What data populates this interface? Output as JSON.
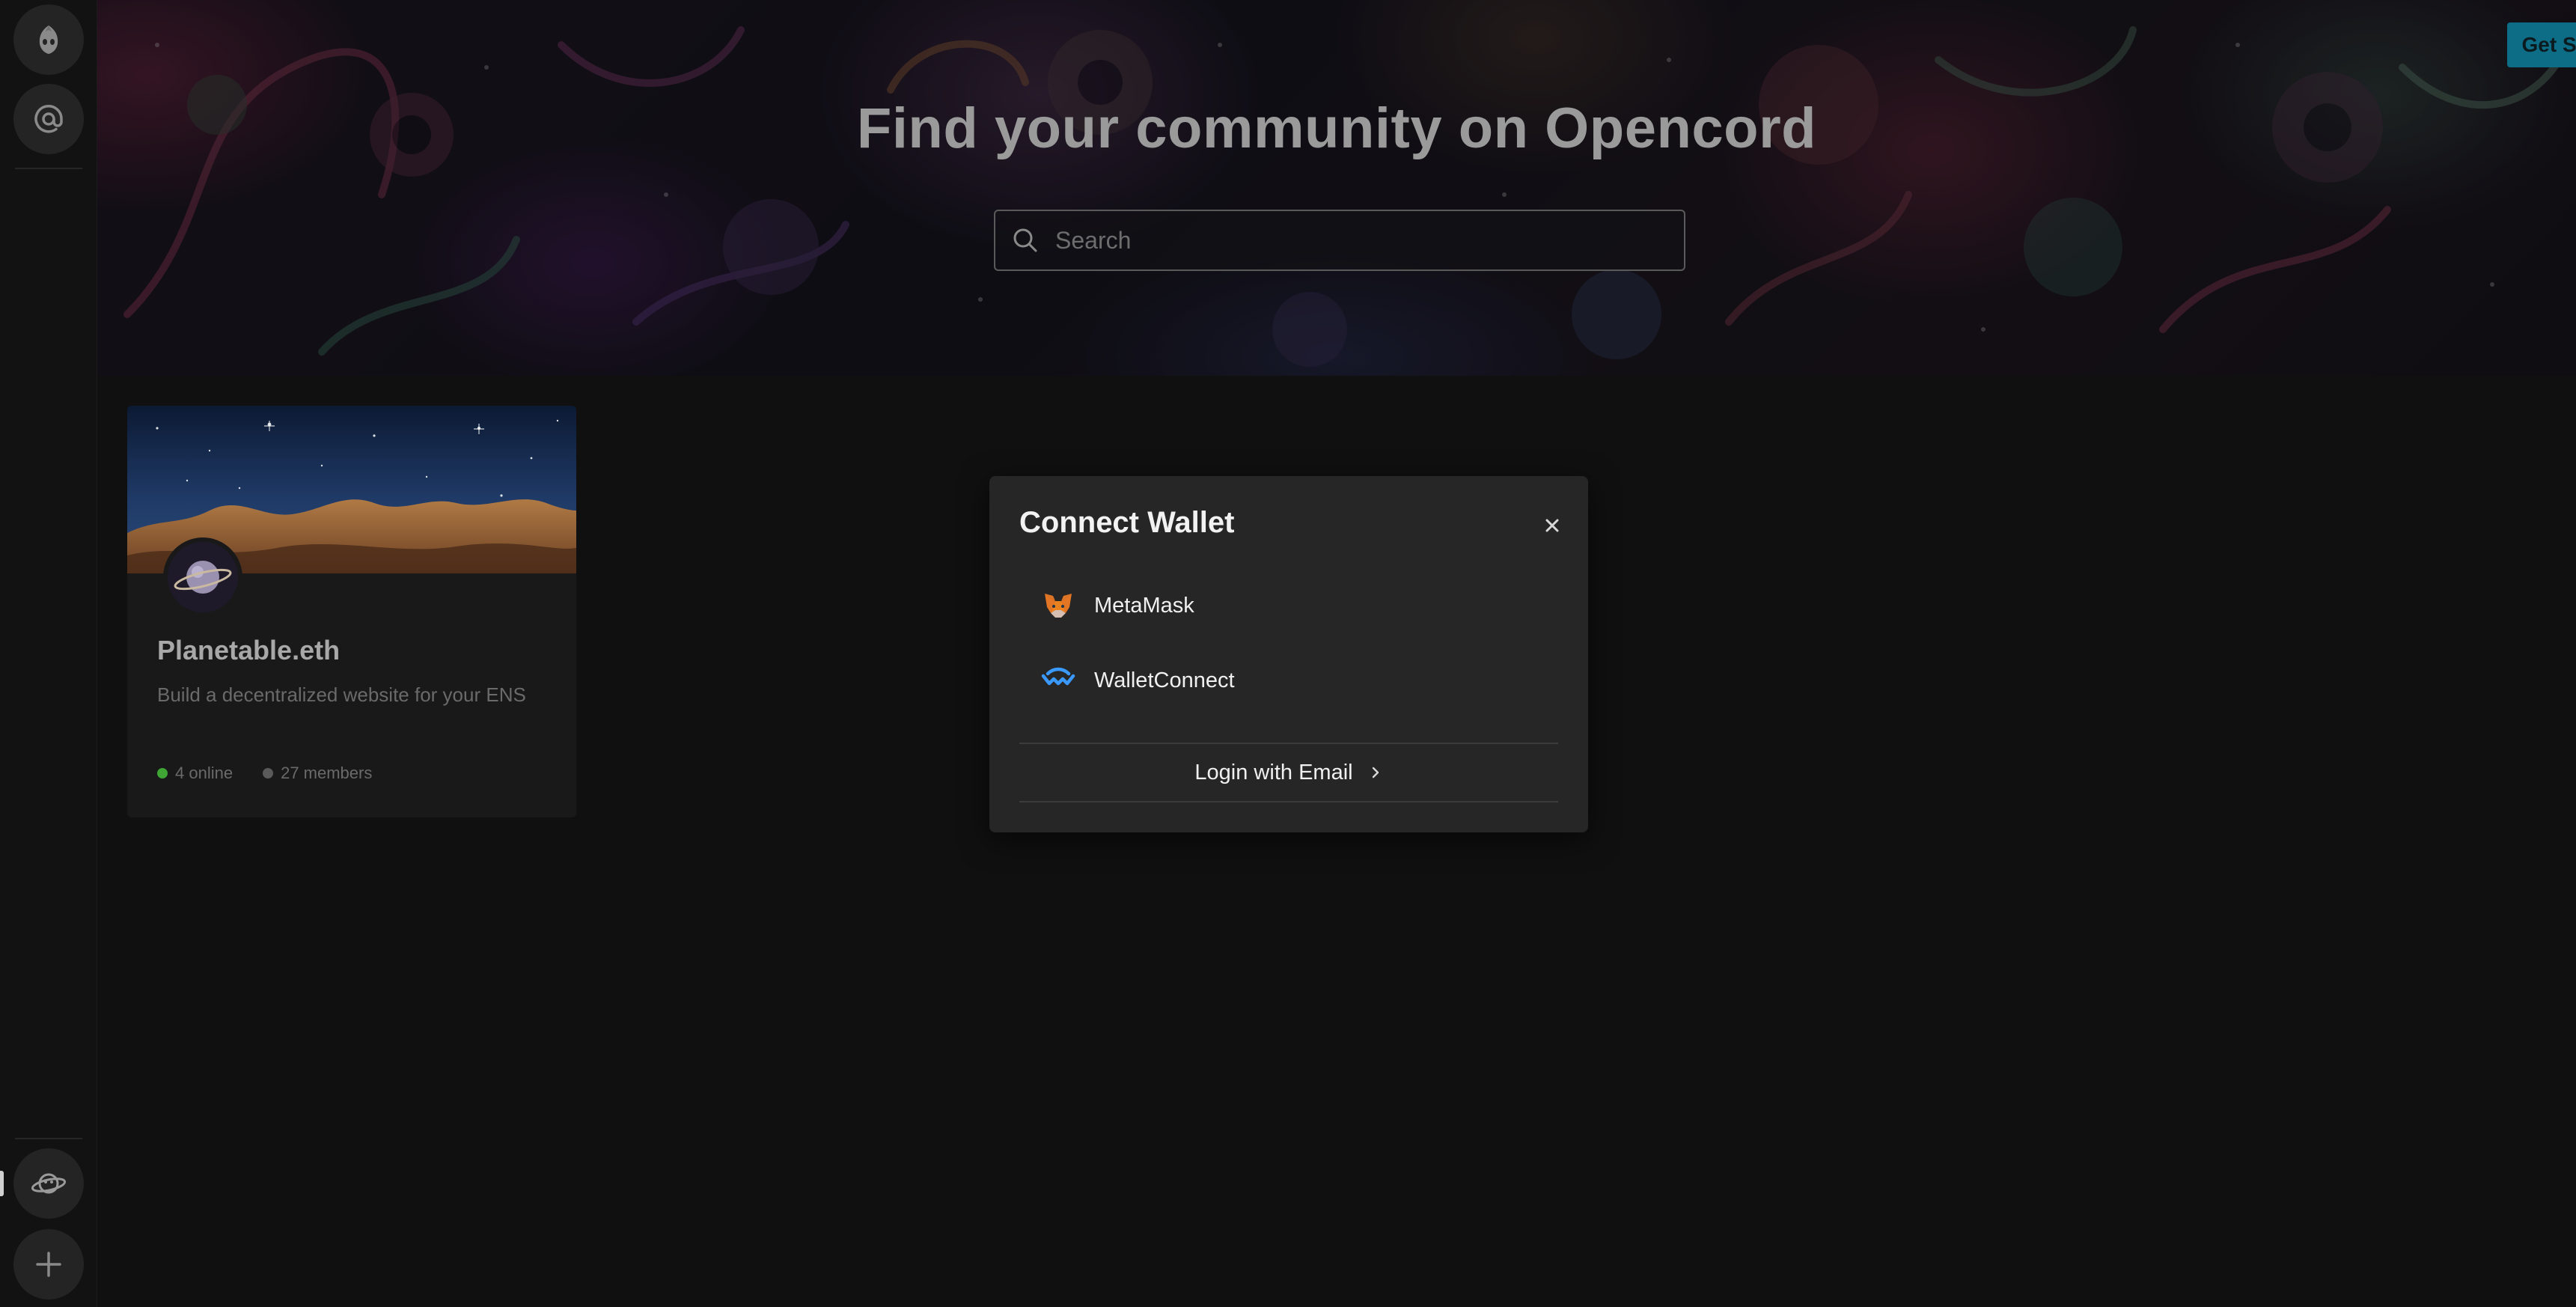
{
  "header": {
    "title": "Find your community on Opencord",
    "get_started_label": "Get Started"
  },
  "search": {
    "placeholder": "Search",
    "value": ""
  },
  "sidebar": {
    "items": [
      {
        "name": "opencord-logo",
        "icon": "opencord-logo-icon"
      },
      {
        "name": "mentions",
        "icon": "at-sign-icon"
      }
    ],
    "bottom_items": [
      {
        "name": "explore",
        "icon": "planet-icon"
      },
      {
        "name": "add-community",
        "icon": "plus-icon"
      }
    ]
  },
  "communities": [
    {
      "name": "Planetable.eth",
      "description": "Build a decentralized website for your ENS",
      "online": "4 online",
      "members": "27 members"
    }
  ],
  "modal": {
    "title": "Connect Wallet",
    "wallets": [
      {
        "label": "MetaMask",
        "icon": "metamask-fox-icon"
      },
      {
        "label": "WalletConnect",
        "icon": "walletconnect-icon"
      }
    ],
    "email_login_label": "Login with Email"
  },
  "colors": {
    "background": "#101010",
    "modal_bg": "#262626",
    "accent": "#0e6d86",
    "online_dot": "#3fa535",
    "member_dot": "#5a5a5a"
  }
}
